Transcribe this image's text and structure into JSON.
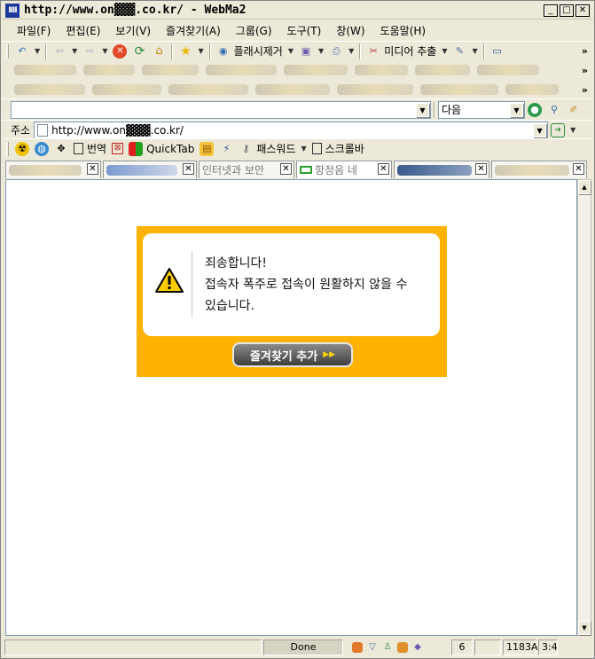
{
  "window": {
    "app_icon": "IIII",
    "title": "http://www.on▓▓▓.co.kr/ - WebMa2",
    "controls": {
      "minimize": "_",
      "maximize": "□",
      "close": "✕"
    }
  },
  "menu": [
    "파일(F)",
    "편집(E)",
    "보기(V)",
    "즐겨찾기(A)",
    "그룹(G)",
    "도구(T)",
    "창(W)",
    "도움말(H)"
  ],
  "toolbar": {
    "flash_remove": "플래시제거",
    "media_extract": "미디어 추출"
  },
  "search": {
    "value": "",
    "next_label": "다음"
  },
  "address": {
    "label": "주소",
    "url": "http://www.on▓▓▓.co.kr/"
  },
  "links": {
    "translate": "번역",
    "quicktab": "QuickTab",
    "password": "패스워드",
    "scrollbar": "스크롤바"
  },
  "tabs": [
    "",
    "",
    "인터넷과 보안",
    "항정음 네",
    "",
    ""
  ],
  "notice": {
    "line1": "죄송합니다!",
    "line2": "접속자 폭주로 접속이 원활하지 않을 수",
    "line3": "있습니다.",
    "button": "즐겨찾기 추가",
    "button_arrow": "▶▶"
  },
  "status": {
    "text": "Done",
    "count": "6",
    "memory": "1183A",
    "ratio": "3:4"
  },
  "colors": {
    "accent_orange": "#ffb300",
    "button_dark": "#4a4a4a"
  }
}
